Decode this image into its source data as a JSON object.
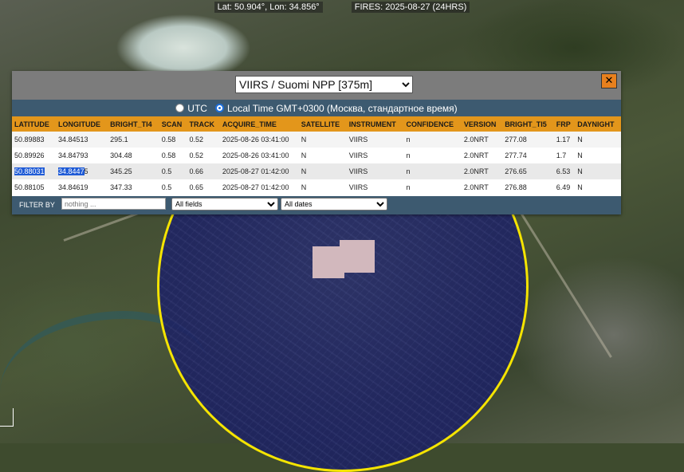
{
  "statusbar": {
    "coords": "Lat: 50.904°, Lon: 34.856°",
    "fires": "FIRES: 2025-08-27 (24HRS)"
  },
  "dialog": {
    "product_selected": "VIIRS / Suomi NPP [375m]",
    "close_label": "✕",
    "timezone": {
      "utc_label": "UTC",
      "local_label": "Local Time GMT+0300 (Москва, стандартное время)",
      "selected": "local"
    },
    "table": {
      "headers": [
        "LATITUDE",
        "LONGITUDE",
        "BRIGHT_TI4",
        "SCAN",
        "TRACK",
        "ACQUIRE_TIME",
        "SATELLITE",
        "INSTRUMENT",
        "CONFIDENCE",
        "VERSION",
        "BRIGHT_TI5",
        "FRP",
        "DAYNIGHT"
      ],
      "rows": [
        [
          "50.89883",
          "34.84513",
          "295.1",
          "0.58",
          "0.52",
          "2025-08-26 03:41:00",
          "N",
          "VIIRS",
          "n",
          "2.0NRT",
          "277.08",
          "1.17",
          "N"
        ],
        [
          "50.89926",
          "34.84793",
          "304.48",
          "0.58",
          "0.52",
          "2025-08-26 03:41:00",
          "N",
          "VIIRS",
          "n",
          "2.0NRT",
          "277.74",
          "1.7",
          "N"
        ],
        [
          "50.88031",
          "34.84475",
          "345.25",
          "0.5",
          "0.66",
          "2025-08-27 01:42:00",
          "N",
          "VIIRS",
          "n",
          "2.0NRT",
          "276.65",
          "6.53",
          "N"
        ],
        [
          "50.88105",
          "34.84619",
          "347.33",
          "0.5",
          "0.65",
          "2025-08-27 01:42:00",
          "N",
          "VIIRS",
          "n",
          "2.0NRT",
          "276.88",
          "6.49",
          "N"
        ]
      ]
    },
    "filter": {
      "label": "FILTER BY",
      "placeholder": "nothing ...",
      "fields_selected": "All fields",
      "dates_selected": "All dates"
    }
  },
  "colors": {
    "header_orange": "#e3961b",
    "bar_blue": "#3d5a70",
    "highlight_circle": "#f5e400",
    "selection": "#1f5bd6"
  }
}
